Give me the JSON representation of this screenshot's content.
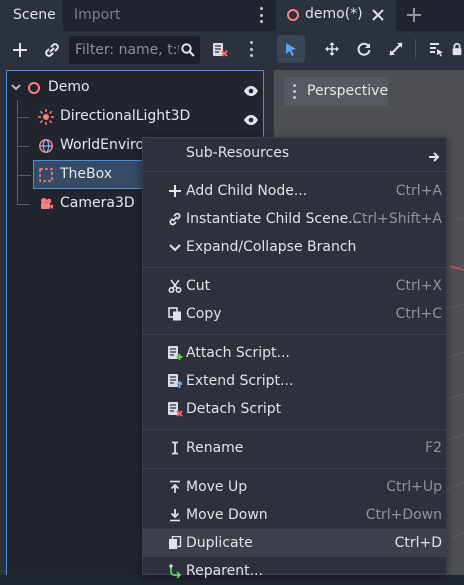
{
  "scene_dock": {
    "tabs": [
      {
        "label": "Scene",
        "active": true
      },
      {
        "label": "Import",
        "active": false
      }
    ],
    "filter_placeholder": "Filter: name, t:t",
    "toolbar_icons": [
      "add-node-icon",
      "link-icon",
      "search-icon",
      "remove-script-icon",
      "kebab-menu-icon"
    ],
    "tree": [
      {
        "label": "Demo",
        "icon": "node3d-icon",
        "depth": 0,
        "visible_toggle": true
      },
      {
        "label": "DirectionalLight3D",
        "icon": "light-icon",
        "depth": 1,
        "visible_toggle": true
      },
      {
        "label": "WorldEnviro",
        "icon": "world-environment-icon",
        "depth": 1
      },
      {
        "label": "TheBox",
        "icon": "mesh-instance-icon",
        "depth": 1,
        "selected": true
      },
      {
        "label": "Camera3D",
        "icon": "camera-icon",
        "depth": 1
      }
    ]
  },
  "editor": {
    "tab_label": "demo(*)",
    "viewport_button": "Perspective"
  },
  "context_menu": {
    "submenu": {
      "label": "Sub-Resources"
    },
    "groups": [
      [
        {
          "label": "Add Child Node...",
          "shortcut": "Ctrl+A",
          "icon": "plus-icon"
        },
        {
          "label": "Instantiate Child Scene...",
          "shortcut": "Ctrl+Shift+A",
          "icon": "instance-link-icon"
        },
        {
          "label": "Expand/Collapse Branch",
          "shortcut": "",
          "icon": "chevron-down-icon"
        }
      ],
      [
        {
          "label": "Cut",
          "shortcut": "Ctrl+X",
          "icon": "scissors-icon"
        },
        {
          "label": "Copy",
          "shortcut": "Ctrl+C",
          "icon": "copy-icon"
        }
      ],
      [
        {
          "label": "Attach Script...",
          "shortcut": "",
          "icon": "attach-script-icon"
        },
        {
          "label": "Extend Script...",
          "shortcut": "",
          "icon": "extend-script-icon"
        },
        {
          "label": "Detach Script",
          "shortcut": "",
          "icon": "detach-script-icon"
        }
      ],
      [
        {
          "label": "Rename",
          "shortcut": "F2",
          "icon": "rename-cursor-icon"
        }
      ],
      [
        {
          "label": "Move Up",
          "shortcut": "Ctrl+Up",
          "icon": "move-up-icon"
        },
        {
          "label": "Move Down",
          "shortcut": "Ctrl+Down",
          "icon": "move-down-icon"
        },
        {
          "label": "Duplicate",
          "shortcut": "Ctrl+D",
          "icon": "duplicate-icon",
          "highlighted": true
        },
        {
          "label": "Reparent...",
          "shortcut": "",
          "icon": "reparent-icon"
        }
      ]
    ]
  },
  "colors": {
    "accent": "#4c8fd6",
    "selection": "#354a64",
    "menu_bg": "#2c313b",
    "menu_highlight": "#3b404a",
    "node3d_red": "#fc7f7f"
  }
}
